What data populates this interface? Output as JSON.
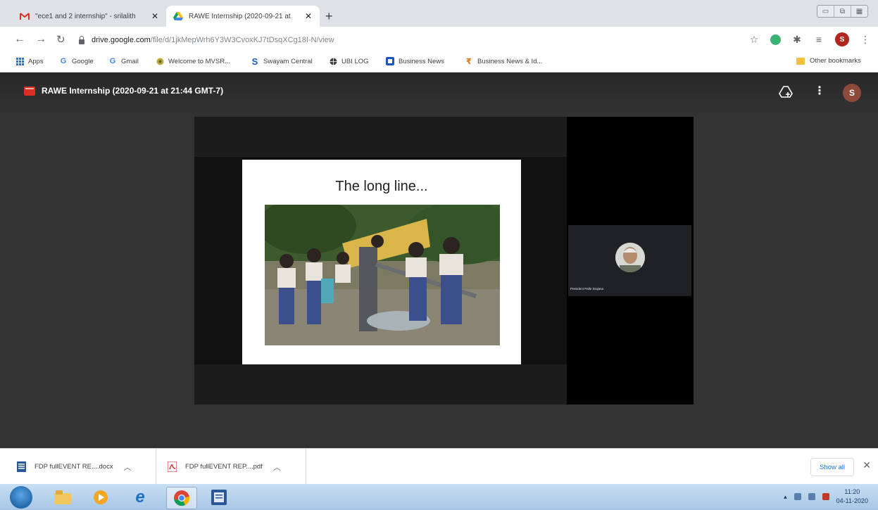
{
  "browser": {
    "tabs": [
      {
        "title": "\"ece1 and 2 internship\" - srilalith",
        "active": false,
        "favicon": "gmail-icon"
      },
      {
        "title": "RAWE Internship (2020-09-21 at",
        "active": true,
        "favicon": "google-drive-icon"
      }
    ],
    "new_tab": "+",
    "url_host": "drive.google.com",
    "url_path": "/file/d/1jkMepWrh6Y3W3CvoxKJ7tDsqXCg18I-N/view",
    "profile_initial": "S"
  },
  "bookmarks": {
    "items": [
      {
        "label": "Apps",
        "icon": "apps-grid-icon"
      },
      {
        "label": "Google",
        "icon": "google-icon"
      },
      {
        "label": "Gmail",
        "icon": "google-icon"
      },
      {
        "label": "Welcome to MVSR...",
        "icon": "mvsr-icon"
      },
      {
        "label": "Swayam Central",
        "icon": "swayam-icon"
      },
      {
        "label": "UBI LOG",
        "icon": "globe-icon"
      },
      {
        "label": "Business News",
        "icon": "news-icon"
      },
      {
        "label": "Business News & Id...",
        "icon": "rupee-icon"
      }
    ],
    "other": "Other bookmarks"
  },
  "viewer": {
    "file_title": "RAWE Internship (2020-09-21 at 21:44 GMT-7)",
    "profile_initial": "S",
    "slide_title": "The long line...",
    "participant_name": "President Palle Srujana"
  },
  "downloads": {
    "items": [
      {
        "name": "FDP fullEVENT RE....docx",
        "icon": "word-doc-icon"
      },
      {
        "name": "FDP fullEVENT REP....pdf",
        "icon": "pdf-icon"
      }
    ],
    "show_all": "Show all",
    "close": "✕"
  },
  "taskbar": {
    "time": "11:20",
    "date": "04-11-2020"
  },
  "colors": {
    "viewer_bg": "#323232",
    "tab_strip": "#dee1e6",
    "accent_blue": "#1a73e8",
    "avatar_red": "#b3261e"
  }
}
